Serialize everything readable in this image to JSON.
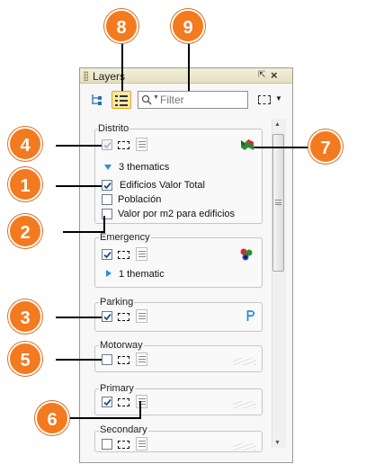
{
  "panel": {
    "title": "Layers",
    "filter": {
      "placeholder": "Filter",
      "value": ""
    }
  },
  "groups": [
    {
      "name": "Distrito",
      "thematics_label": "3 thematics",
      "items": [
        {
          "label": "Edificios Valor Total",
          "checked": true
        },
        {
          "label": "Población",
          "checked": false
        },
        {
          "label": "Valor por m2 para edificios",
          "checked": false
        }
      ]
    },
    {
      "name": "Emergency",
      "thematics_label": "1 thematic"
    },
    {
      "name": "Parking"
    },
    {
      "name": "Motorway"
    },
    {
      "name": "Primary"
    },
    {
      "name": "Secondary"
    }
  ],
  "callouts": [
    "8",
    "9",
    "4",
    "1",
    "7",
    "2",
    "3",
    "5",
    "6"
  ],
  "colors": {
    "callout": "#f37a1f",
    "accent_blue": "#2a8fd6",
    "toolbar_active": "#fde8a6"
  }
}
